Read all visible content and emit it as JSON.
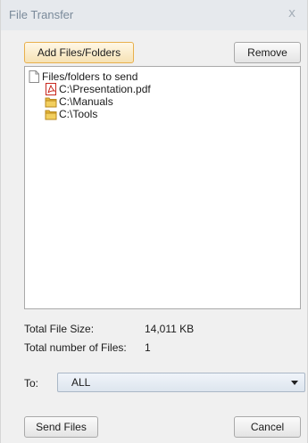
{
  "window": {
    "title": "File Transfer",
    "close_glyph": "x"
  },
  "toolbar": {
    "add_label": "Add Files/Folders",
    "remove_label": "Remove"
  },
  "tree": {
    "root": {
      "label": "Files/folders to send",
      "icon": "document-icon"
    },
    "items": [
      {
        "label": "C:\\Presentation.pdf",
        "icon": "pdf-icon"
      },
      {
        "label": "C:\\Manuals",
        "icon": "folder-icon"
      },
      {
        "label": "C:\\Tools",
        "icon": "folder-icon"
      }
    ]
  },
  "summary": {
    "size_label": "Total File Size:",
    "size_value": "14,011 KB",
    "count_label": "Total number of Files:",
    "count_value": "1"
  },
  "destination": {
    "label": "To:",
    "selected": "ALL"
  },
  "footer": {
    "send_label": "Send Files",
    "cancel_label": "Cancel"
  },
  "colors": {
    "accent_border": "#e8b04c",
    "folder": "#e6b83a",
    "pdf": "#c8281e"
  }
}
